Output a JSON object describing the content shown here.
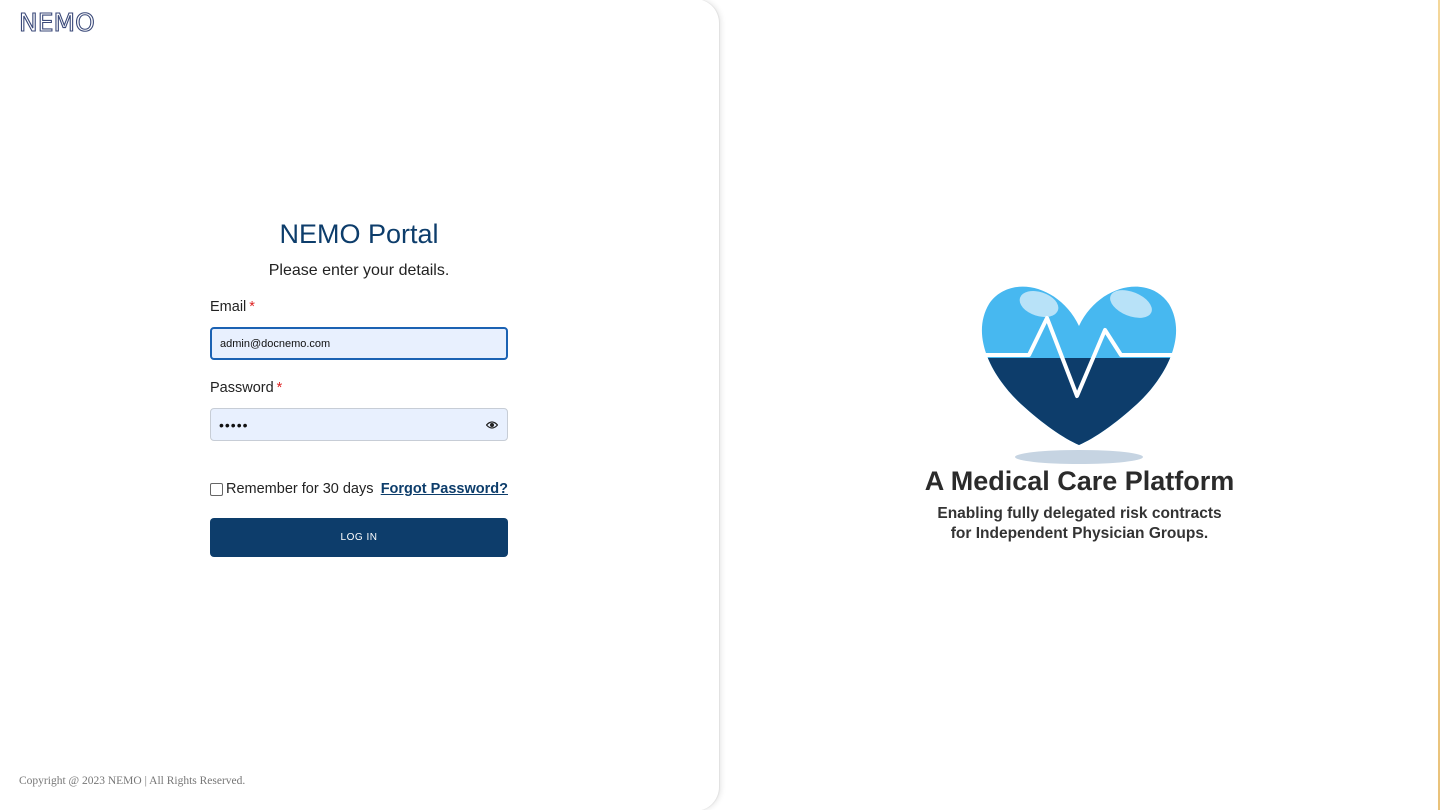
{
  "brand": {
    "logo_text": "NEMO"
  },
  "form": {
    "title": "NEMO Portal",
    "subtitle": "Please enter your details.",
    "email_label": "Email",
    "email_value": "admin@docnemo.com",
    "password_label": "Password",
    "password_value": "•••••",
    "required_mark": "*",
    "remember_label": "Remember for 30 days",
    "remember_checked": false,
    "forgot_label": "Forgot Password?",
    "login_label": "LOG IN"
  },
  "footer": {
    "copyright": "Copyright @ 2023 NEMO | All Rights Reserved."
  },
  "hero": {
    "headline": "A Medical Care Platform",
    "line1": "Enabling fully delegated risk contracts",
    "line2": "for Independent Physician Groups."
  },
  "colors": {
    "brand_navy": "#0d3d6b",
    "heart_light": "#47b8f0",
    "heart_dark": "#0d3d6b",
    "input_bg": "#e8f0fe",
    "focus_border": "#1b62b3"
  },
  "icons": {
    "password_toggle": "eye-icon",
    "hero_image": "heart-pulse-icon"
  }
}
